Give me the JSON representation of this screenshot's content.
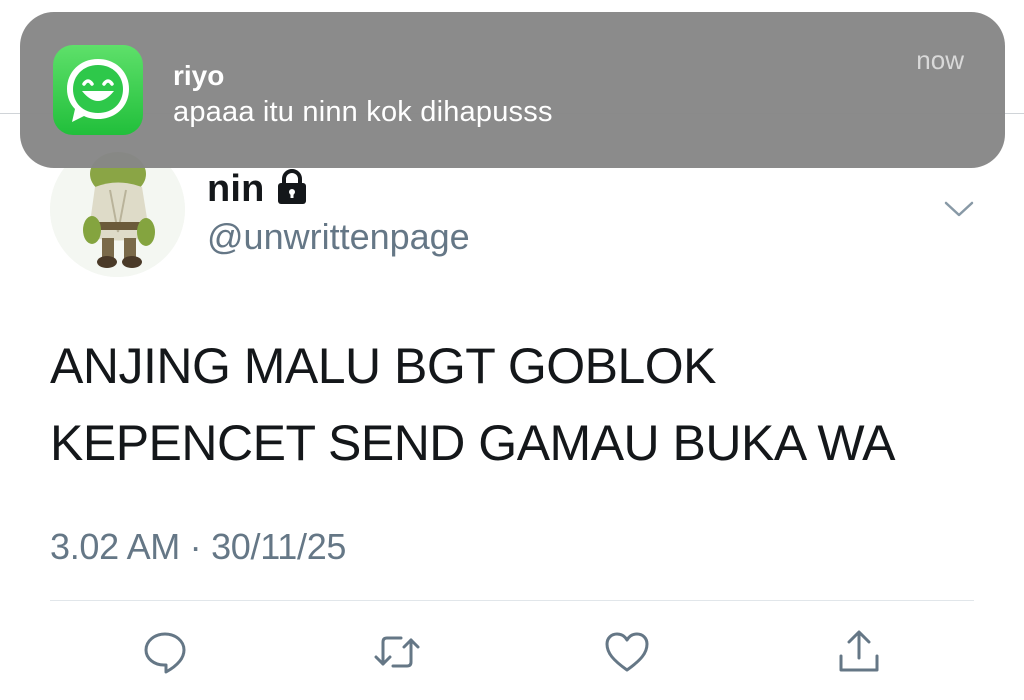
{
  "notification": {
    "app_icon": "smiley-chat-icon",
    "sender": "riyo",
    "message": "apaaa itu ninn kok dihapusss",
    "time": "now"
  },
  "tweet": {
    "author_name": "nin",
    "protected_icon": "lock-icon",
    "handle": "@unwrittenpage",
    "text_lines": [
      "ANJING MALU BGT GOBLOK",
      "KEPENCET SEND GAMAU BUKA WA"
    ],
    "timestamp": "3.02 AM · 30/11/25"
  },
  "actions": [
    {
      "name": "reply",
      "icon": "reply-icon"
    },
    {
      "name": "retweet",
      "icon": "retweet-icon"
    },
    {
      "name": "like",
      "icon": "heart-icon"
    },
    {
      "name": "share",
      "icon": "share-icon"
    }
  ],
  "colors": {
    "text": "#14171a",
    "secondary": "#657786",
    "icon": "#657786",
    "notification_bg": "#878787",
    "app_icon_green": "#2ec84a"
  }
}
